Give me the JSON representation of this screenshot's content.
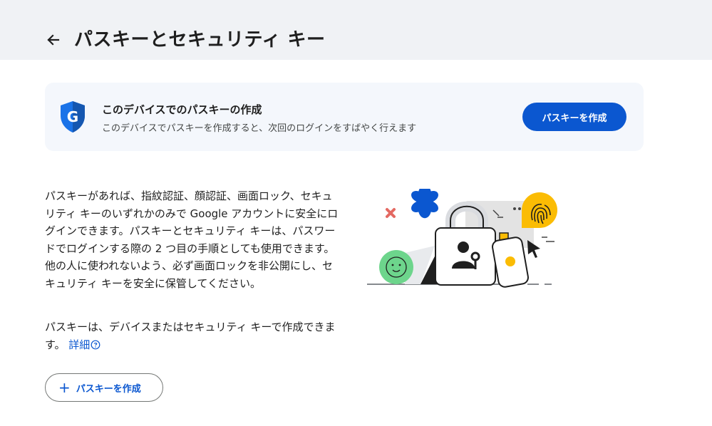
{
  "header": {
    "title": "パスキーとセキュリティ キー",
    "back_icon": "arrow-back-icon"
  },
  "banner": {
    "icon": "google-shield-icon",
    "title": "このデバイスでのパスキーの作成",
    "description": "このデバイスでパスキーを作成すると、次回のログインをすばやく行えます",
    "button_label": "パスキーを作成",
    "accent_color": "#0b57d0"
  },
  "main": {
    "paragraph1": "パスキーがあれば、指紋認証、顔認証、画面ロック、セキュリティ キーのいずれかのみで Google アカウントに安全にログインできます。パスキーとセキュリティ キーは、パスワードでログインする際の 2 つ目の手順としても使用できます。他の人に使われないよう、必ず画面ロックを非公開にし、セキュリティ キーを安全に保管してください。",
    "paragraph2": "パスキーは、デバイスまたはセキュリティ キーで作成できます。",
    "learn_more": "詳細",
    "create_button": "パスキーを作成",
    "create_icon": "plus-icon",
    "help_icon": "help-icon"
  }
}
